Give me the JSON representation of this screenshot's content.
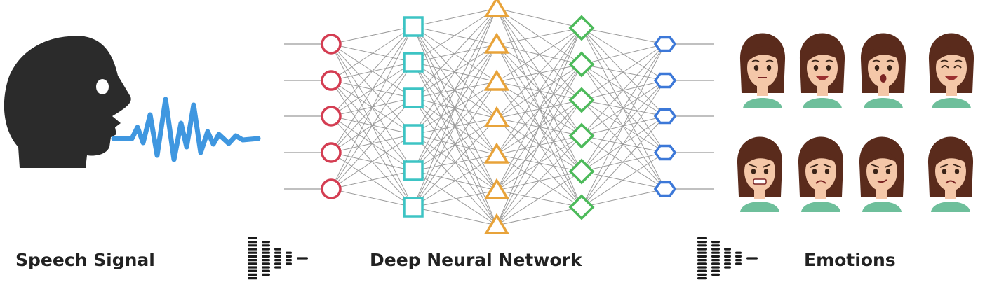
{
  "labels": {
    "speech_signal": "Speech Signal",
    "deep_neural_network": "Deep Neural Network",
    "emotions": "Emotions"
  },
  "network": {
    "layers": [
      {
        "shape": "circle",
        "color": "#d43d52",
        "count": 5
      },
      {
        "shape": "square",
        "color": "#3dc4c4",
        "count": 6
      },
      {
        "shape": "triangle",
        "color": "#e8a33a",
        "count": 7
      },
      {
        "shape": "diamond",
        "color": "#4cba5a",
        "count": 6
      },
      {
        "shape": "hexagon",
        "color": "#3c78d8",
        "count": 5
      }
    ],
    "edge_color": "#9a9a9a"
  },
  "colors": {
    "head": "#2b2b2b",
    "wave": "#3f97e0",
    "skin": "#f4c7a8",
    "hair": "#5a2b1c",
    "shirt": "#6ebf9b",
    "bars": "#1a1a1a"
  },
  "emotions": {
    "faces": [
      {
        "expression": "neutral"
      },
      {
        "expression": "happy"
      },
      {
        "expression": "surprised"
      },
      {
        "expression": "laughing"
      },
      {
        "expression": "angry"
      },
      {
        "expression": "sad"
      },
      {
        "expression": "disgusted"
      },
      {
        "expression": "worried"
      }
    ]
  }
}
